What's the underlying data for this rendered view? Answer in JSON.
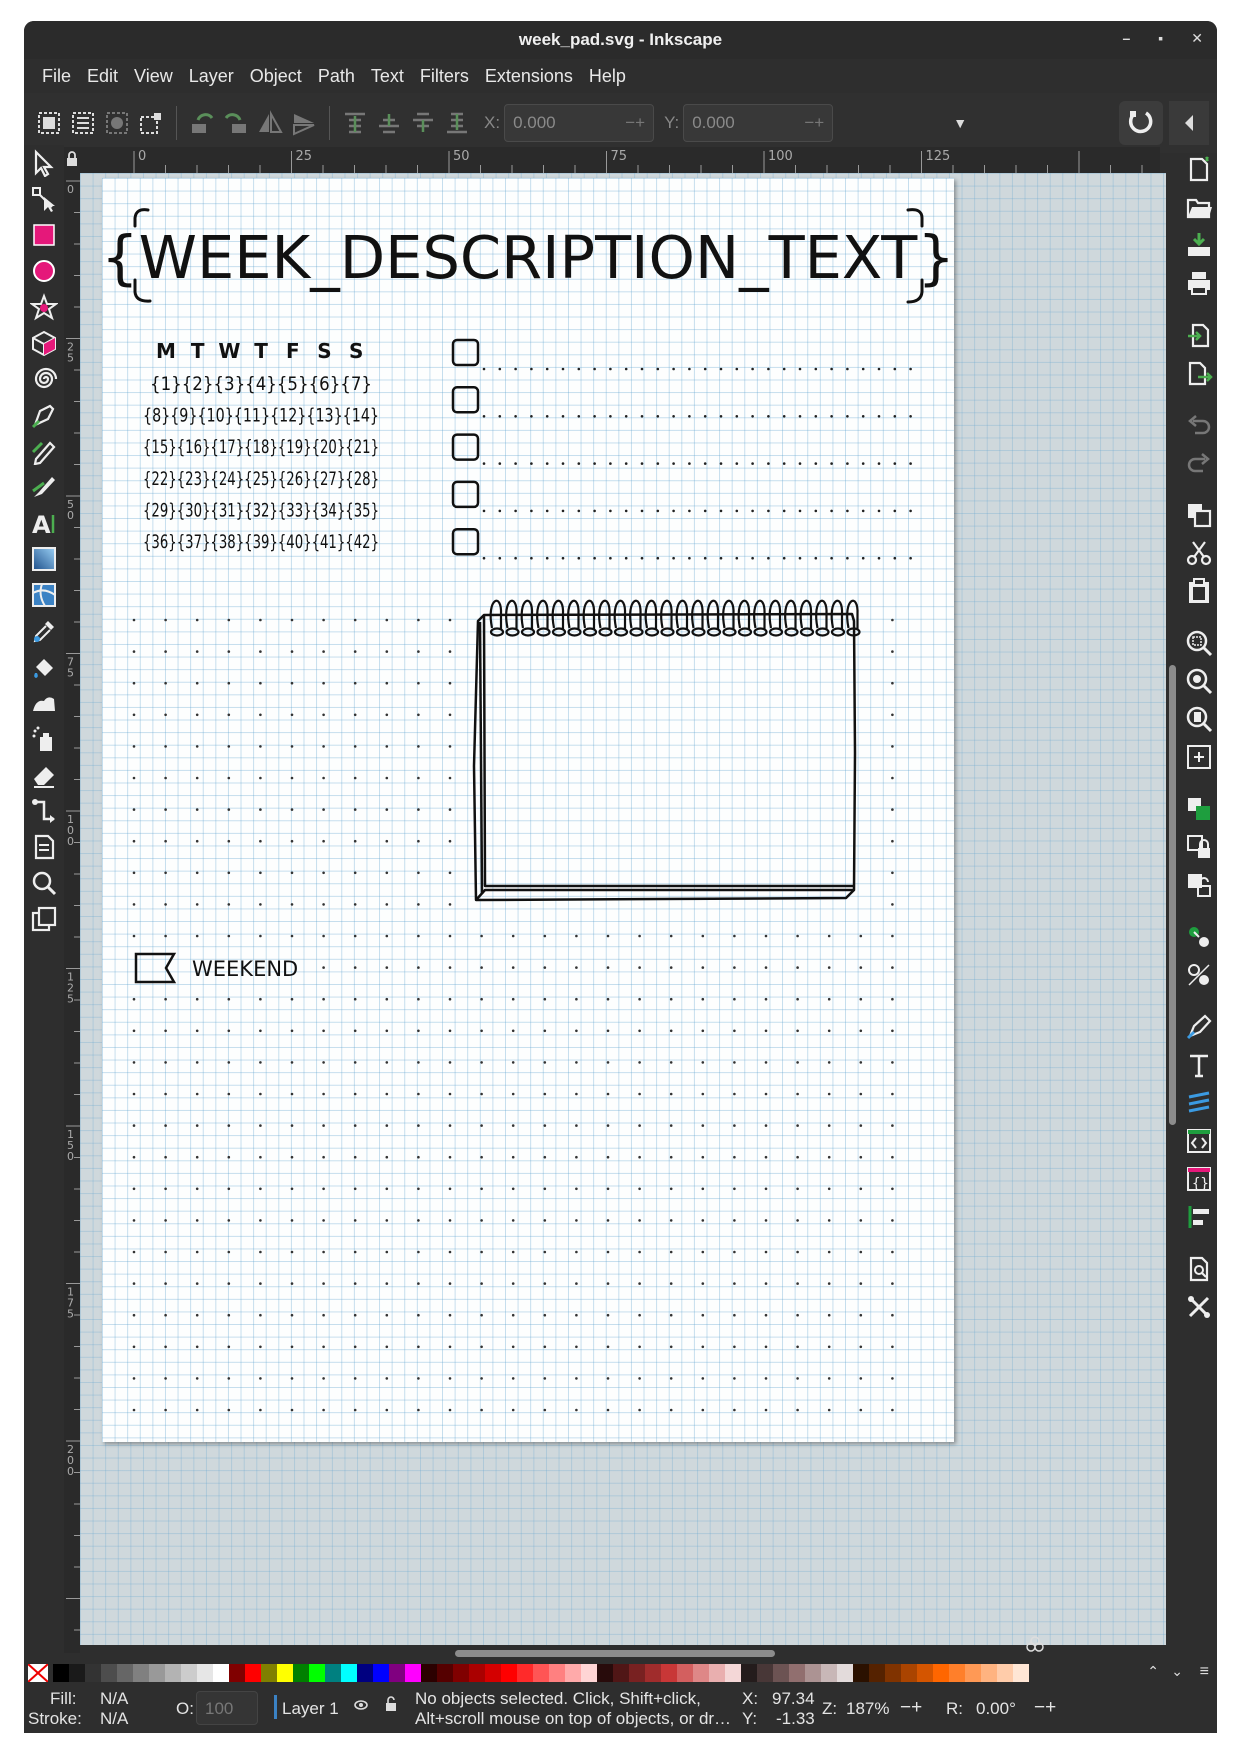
{
  "window": {
    "title": "week_pad.svg - Inkscape",
    "controls": [
      "–",
      "▪",
      "✕"
    ]
  },
  "menu": [
    "File",
    "Edit",
    "View",
    "Layer",
    "Object",
    "Path",
    "Text",
    "Filters",
    "Extensions",
    "Help"
  ],
  "toolbar": {
    "x_label": "X:",
    "x_value": "0.000",
    "y_label": "Y:",
    "y_value": "0.000",
    "spin_symbols": "−+"
  },
  "ruler": {
    "h_ticks": [
      "0",
      "25",
      "50",
      "75",
      "100",
      "125"
    ],
    "v_ticks": [
      "0",
      "25",
      "50",
      "75",
      "100",
      "125",
      "150",
      "175",
      "200"
    ]
  },
  "document": {
    "title_placeholder": "{WEEK_DESCRIPTION_TEXT}",
    "weekday_header": [
      "M",
      "T",
      "W",
      "T",
      "F",
      "S",
      "S"
    ],
    "calendar_rows": [
      "{1}{2}{3}{4}{5}{6}{7}",
      "{8}{9}{10}{11}{12}{13}{14}",
      "{15}{16}{17}{18}{19}{20}{21}",
      "{22}{23}{24}{25}{26}{27}{28}",
      "{29}{30}{31}{32}{33}{34}{35}",
      "{36}{37}{38}{39}{40}{41}{42}"
    ],
    "todo_count": 5,
    "weekend_label": "WEEKEND"
  },
  "palette_colors": [
    "#000000",
    "#1a1a1a",
    "#333333",
    "#4d4d4d",
    "#666666",
    "#808080",
    "#999999",
    "#b3b3b3",
    "#cccccc",
    "#e6e6e6",
    "#ffffff",
    "#800000",
    "#ff0000",
    "#808000",
    "#ffff00",
    "#008000",
    "#00ff00",
    "#008080",
    "#00ffff",
    "#000080",
    "#0000ff",
    "#800080",
    "#ff00ff",
    "#2b0000",
    "#550000",
    "#800000",
    "#aa0000",
    "#d40000",
    "#ff0000",
    "#ff2a2a",
    "#ff5555",
    "#ff8080",
    "#ffaaaa",
    "#ffd5d5",
    "#280b0b",
    "#501616",
    "#782121",
    "#a02c2c",
    "#c83737",
    "#d35f5f",
    "#de8787",
    "#e9afaf",
    "#f4d7d7",
    "#241c1c",
    "#483737",
    "#6c5353",
    "#916f6f",
    "#ac9393",
    "#c8b7b7",
    "#e3dbdb",
    "#2b1100",
    "#552200",
    "#803300",
    "#aa4400",
    "#d45500",
    "#ff6600",
    "#ff7f2a",
    "#ff9955",
    "#ffb380",
    "#ffccaa",
    "#ffe6d5"
  ],
  "status": {
    "fill_label": "Fill:",
    "fill_value": "N/A",
    "stroke_label": "Stroke:",
    "stroke_value": "N/A",
    "opacity_label": "O:",
    "opacity_value": "100",
    "layer": "Layer 1",
    "message_line1": "No objects selected. Click, Shift+click,",
    "message_line2": "Alt+scroll mouse on top of objects, or dr…",
    "x_label": "X:",
    "x_value": "97.34",
    "y_label": "Y:",
    "y_value": "-1.33",
    "zoom_label": "Z:",
    "zoom_value": "187%",
    "rotation_label": "R:",
    "rotation_value": "0.00°",
    "spin_symbols": "−+"
  },
  "accent_colors": {
    "rect_tool": "#e5187a",
    "ellipse_tool": "#e5187a",
    "snap_green": "#4caf50"
  }
}
